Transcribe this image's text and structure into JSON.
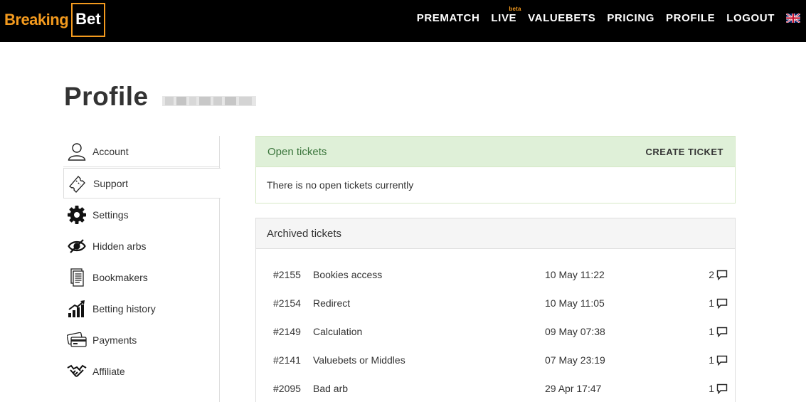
{
  "brand": {
    "part1": "Breaking",
    "part2": "Bet",
    "accent": "#f39a1e"
  },
  "nav": {
    "items": [
      "PREMATCH",
      "LIVE",
      "VALUEBETS",
      "PRICING",
      "PROFILE",
      "LOGOUT"
    ],
    "live_badge": "beta",
    "language_flag": "uk-flag-icon"
  },
  "page": {
    "title": "Profile"
  },
  "sidebar": {
    "items": [
      {
        "label": "Account",
        "icon": "user-icon"
      },
      {
        "label": "Support",
        "icon": "ticket-icon"
      },
      {
        "label": "Settings",
        "icon": "gear-icon"
      },
      {
        "label": "Hidden arbs",
        "icon": "eye-slash-icon"
      },
      {
        "label": "Bookmakers",
        "icon": "document-icon"
      },
      {
        "label": "Betting history",
        "icon": "chart-icon"
      },
      {
        "label": "Payments",
        "icon": "payment-card-icon"
      },
      {
        "label": "Affiliate",
        "icon": "handshake-icon"
      }
    ],
    "active": "Support"
  },
  "open_tickets": {
    "title": "Open tickets",
    "create_label": "CREATE TICKET",
    "empty_message": "There is no open tickets currently",
    "header_color": "#dff0d8"
  },
  "archived_tickets": {
    "title": "Archived tickets",
    "rows": [
      {
        "id": "#2155",
        "subject": "Bookies access",
        "date": "10 May 11:22",
        "comments": "2"
      },
      {
        "id": "#2154",
        "subject": "Redirect",
        "date": "10 May 11:05",
        "comments": "1"
      },
      {
        "id": "#2149",
        "subject": "Calculation",
        "date": "09 May 07:38",
        "comments": "1"
      },
      {
        "id": "#2141",
        "subject": "Valuebets or Middles",
        "date": "07 May 23:19",
        "comments": "1"
      },
      {
        "id": "#2095",
        "subject": "Bad arb",
        "date": "29 Apr 17:47",
        "comments": "1"
      }
    ]
  }
}
